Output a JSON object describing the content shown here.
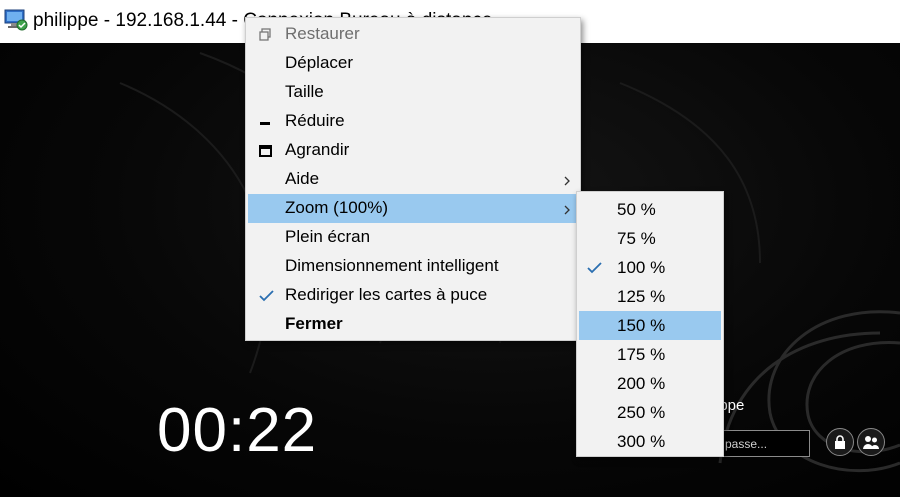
{
  "window": {
    "title": "philippe - 192.168.1.44 - Connexion Bureau à distance",
    "icon": "remote-desktop-icon"
  },
  "system_menu": {
    "items": [
      {
        "label": "Restaurer",
        "icon": "restore-icon",
        "state": "disabled"
      },
      {
        "label": "Déplacer"
      },
      {
        "label": "Taille"
      },
      {
        "label": "Réduire",
        "icon": "minimize-icon"
      },
      {
        "label": "Agrandir",
        "icon": "maximize-icon"
      },
      {
        "label": "Aide",
        "submenu": true
      },
      {
        "label": "Zoom (100%)",
        "submenu": true,
        "state": "highlighted"
      },
      {
        "label": "Plein écran"
      },
      {
        "label": "Dimensionnement intelligent"
      },
      {
        "label": "Rediriger les cartes à puce",
        "icon": "checkmark-icon",
        "checked": true
      },
      {
        "label": "Fermer",
        "bold": true
      }
    ]
  },
  "zoom_submenu": {
    "items": [
      {
        "label": "50 %"
      },
      {
        "label": "75 %"
      },
      {
        "label": "100 %",
        "checked": true
      },
      {
        "label": "125 %"
      },
      {
        "label": "150 %",
        "state": "highlighted"
      },
      {
        "label": "175 %"
      },
      {
        "label": "200 %"
      },
      {
        "label": "250 %"
      },
      {
        "label": "300 %"
      }
    ]
  },
  "lock_screen": {
    "clock": "00:22",
    "user_name": "ippe",
    "password_placeholder": "passe..."
  },
  "colors": {
    "menu_background": "#f2f2f2",
    "highlight": "#99c9ef",
    "check": "#2a6eb0",
    "desktop_background": "#000000"
  }
}
